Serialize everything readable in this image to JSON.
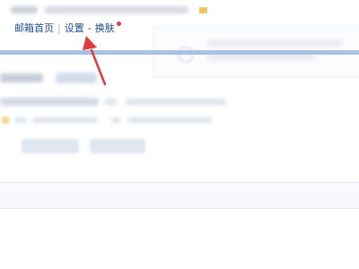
{
  "header": {
    "nav": {
      "home_label": "邮箱首页",
      "separator": "|",
      "settings_label": "设置",
      "dash": "-",
      "skin_label": "换肤"
    }
  },
  "colors": {
    "link": "#1f4d8c",
    "accent_band": "#a9c2e3",
    "notification_dot": "#e0393e",
    "annotation_arrow": "#e0393e"
  },
  "icons": {
    "annotation": "red-arrow-icon",
    "notification": "red-dot-icon",
    "info": "info-circle-icon"
  }
}
